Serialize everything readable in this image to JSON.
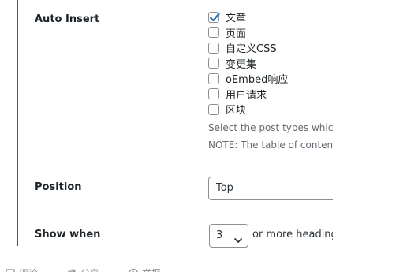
{
  "settings": {
    "auto_insert": {
      "label": "Auto Insert",
      "options": [
        {
          "label": "文章",
          "checked": true
        },
        {
          "label": "页面",
          "checked": false
        },
        {
          "label": "自定义CSS",
          "checked": false
        },
        {
          "label": "变更集",
          "checked": false
        },
        {
          "label": "oEmbed响应",
          "checked": false
        },
        {
          "label": "用户请求",
          "checked": false
        },
        {
          "label": "区块",
          "checked": false
        }
      ],
      "description": "Select the post types whic",
      "note": "NOTE: The table of contents"
    },
    "position": {
      "label": "Position",
      "value": "Top"
    },
    "show_when": {
      "label": "Show when",
      "value": "3",
      "suffix": "or more heading"
    }
  },
  "footer": {
    "items": [
      {
        "label": "评论",
        "icon": "comment-icon"
      },
      {
        "label": "分享",
        "icon": "share-icon"
      },
      {
        "label": "举报",
        "icon": "report-icon"
      }
    ]
  },
  "colors": {
    "accent": "#2271b1",
    "text": "#1d2327",
    "muted": "#646970",
    "border": "#8c8f94"
  }
}
